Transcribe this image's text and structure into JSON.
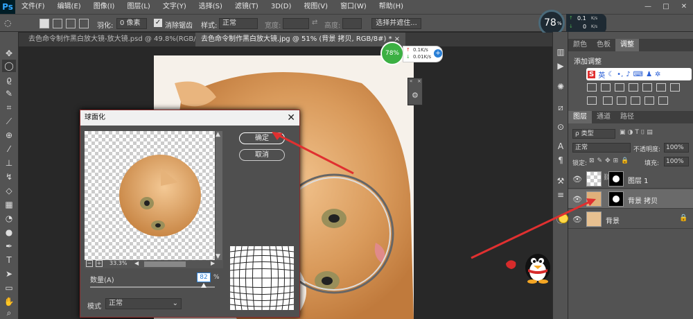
{
  "app": {
    "logo": "Ps"
  },
  "menubar": {
    "items": [
      "文件(F)",
      "编辑(E)",
      "图像(I)",
      "图层(L)",
      "文字(Y)",
      "选择(S)",
      "滤镜(T)",
      "3D(D)",
      "视图(V)",
      "窗口(W)",
      "帮助(H)"
    ],
    "min": "—",
    "max": "□",
    "close": "✕"
  },
  "optionsbar": {
    "feather_label": "羽化:",
    "feather_value": "0 像素",
    "antialias_label": "消除锯齿",
    "style_label": "样式:",
    "style_value": "正常",
    "width_label": "宽度:",
    "height_label": "高度:",
    "select_mask_button": "选择并遮住..."
  },
  "tabs": [
    {
      "label": "去色命令制作黑白放大镜-放大镜.psd @ 49.8%(RGB/8#)",
      "close": "×"
    },
    {
      "label": "去色命令制作黑白放大镜.jpg @ 51% (背景 拷贝, RGB/8#) *",
      "close": "×"
    }
  ],
  "speed_widget_top": {
    "percent": "78",
    "unit": "%",
    "up": "0.1",
    "up_unit": "K/s",
    "down": "0",
    "down_unit": "K/s"
  },
  "speed_widget_mid": {
    "percent": "78%",
    "up": "0.1K/s",
    "down": "0.01K/s",
    "plus": "+"
  },
  "panels": {
    "top_tabs": [
      "颜色",
      "色板",
      "调整"
    ],
    "adjust_title": "添加调整",
    "ime_text": "英",
    "layer_tabs": [
      "图层",
      "通道",
      "路径"
    ],
    "filter_label": "ρ 类型",
    "blend_mode": "正常",
    "opacity_label": "不透明度:",
    "opacity_value": "100%",
    "lock_label": "锁定:",
    "fill_label": "填充:",
    "fill_value": "100%",
    "layers": [
      {
        "name": "图层 1"
      },
      {
        "name": "背景 拷贝"
      },
      {
        "name": "背景"
      }
    ]
  },
  "dialog": {
    "title": "球面化",
    "ok": "确定",
    "cancel": "取消",
    "zoom": "33.3%",
    "amount_label": "数量(A)",
    "amount_value": "82",
    "amount_unit": "%",
    "amount_fraction": 0.82,
    "mode_label": "模式",
    "mode_value": "正常"
  },
  "colors": {
    "ps_blue": "#31a8ff",
    "arrow_red": "#e03030",
    "green": "#3cb043"
  }
}
